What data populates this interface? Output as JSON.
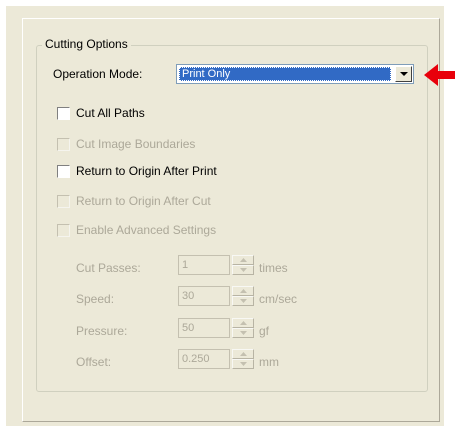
{
  "group": {
    "title": "Cutting Options"
  },
  "operation_mode": {
    "label": "Operation Mode:",
    "value": "Print Only"
  },
  "checkboxes": [
    {
      "label": "Cut All Paths",
      "checked": false,
      "enabled": true
    },
    {
      "label": "Cut Image Boundaries",
      "checked": false,
      "enabled": false
    },
    {
      "label": "Return to Origin After Print",
      "checked": false,
      "enabled": true
    },
    {
      "label": "Return to Origin After Cut",
      "checked": false,
      "enabled": false
    },
    {
      "label": "Enable Advanced Settings",
      "checked": false,
      "enabled": false
    }
  ],
  "fields": [
    {
      "label": "Cut Passes:",
      "value": "1",
      "unit": "times"
    },
    {
      "label": "Speed:",
      "value": "30",
      "unit": "cm/sec"
    },
    {
      "label": "Pressure:",
      "value": "50",
      "unit": "gf"
    },
    {
      "label": "Offset:",
      "value": "0.250",
      "unit": "mm"
    }
  ],
  "colors": {
    "selection": "#316ac5",
    "annotation_arrow": "#e8000b",
    "disabled_text": "#aca899"
  },
  "icons": {
    "dropdown": "chevron-down-icon",
    "annotation": "arrow-left-icon"
  }
}
